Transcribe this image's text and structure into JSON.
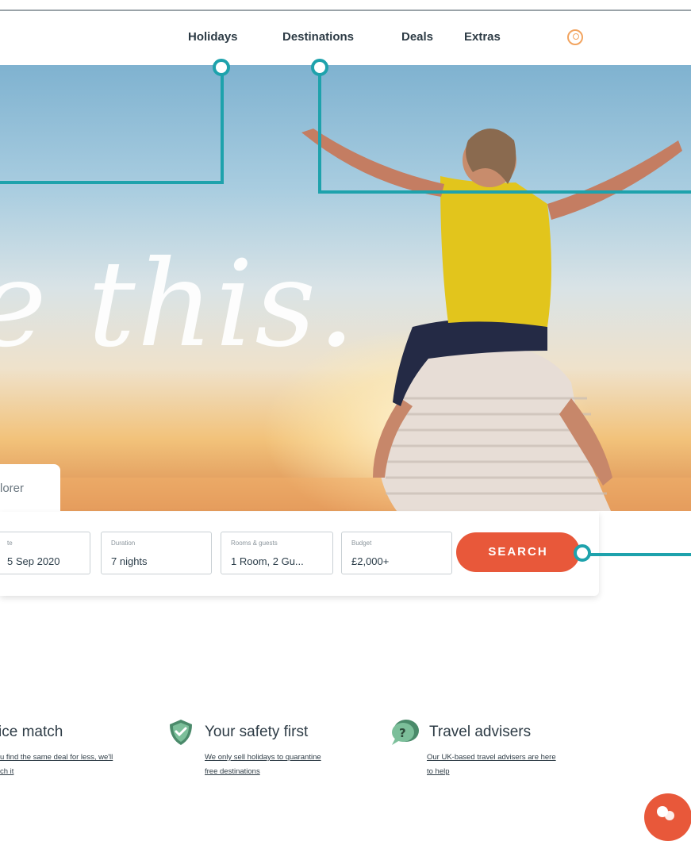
{
  "nav": {
    "items": [
      "Holidays",
      "Destinations",
      "Deals",
      "Extras"
    ]
  },
  "hero": {
    "script_text": "e this."
  },
  "search_panel": {
    "tab_label": "lorer",
    "fields": [
      {
        "label": "te",
        "value": "5 Sep 2020"
      },
      {
        "label": "Duration",
        "value": "7 nights"
      },
      {
        "label": "Rooms & guests",
        "value": "1 Room, 2 Gu..."
      },
      {
        "label": "Budget",
        "value": "£2,000+"
      }
    ],
    "search_label": "SEARCH"
  },
  "usps": [
    {
      "title": "ice match",
      "text_line1": "u find the same deal for less, we'll",
      "text_line2": "ch it"
    },
    {
      "title": "Your safety first",
      "text_line1": "We only sell holidays to quarantine",
      "text_line2": "free destinations"
    },
    {
      "title": "Travel advisers",
      "text_line1": "Our UK-based travel advisers are here",
      "text_line2": "to help"
    }
  ],
  "colors": {
    "accent": "#e8583a",
    "callout": "#1ea2ac",
    "text": "#2d3b45"
  },
  "icons": [
    "user-icon",
    "shield-check-icon",
    "chat-bubbles-icon",
    "speech-bubble-icon"
  ]
}
